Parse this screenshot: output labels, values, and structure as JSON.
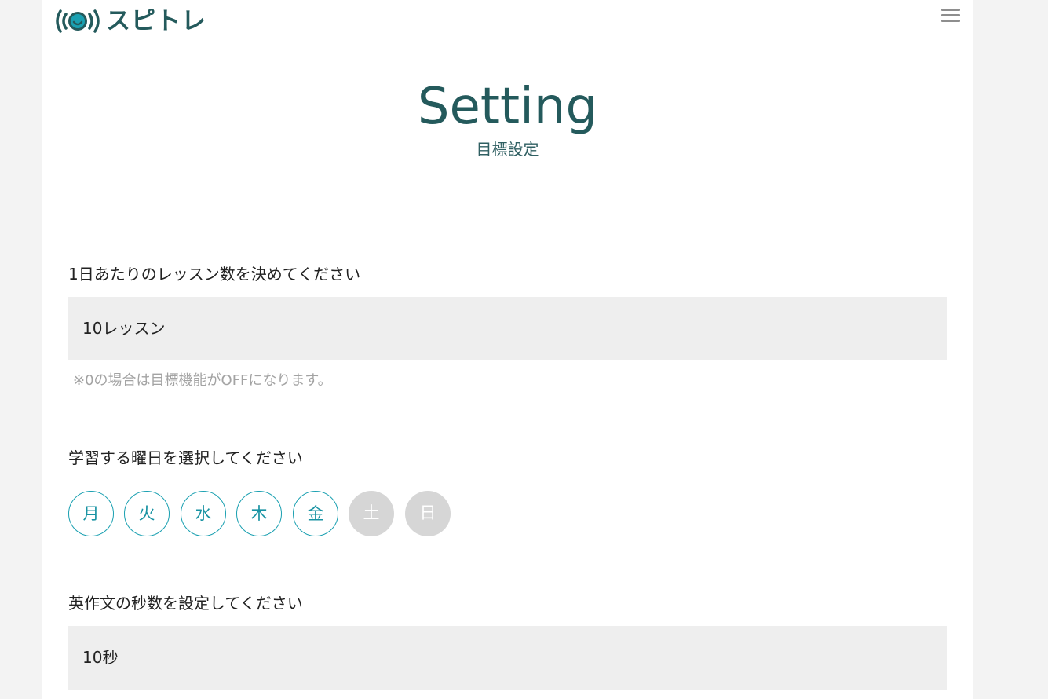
{
  "header": {
    "logo_text": "スピトレ",
    "logo_icon": "sound-wave-face-icon",
    "menu_icon": "hamburger-menu-icon"
  },
  "page": {
    "title": "Setting",
    "subtitle": "目標設定"
  },
  "lessons": {
    "label": "1日あたりのレッスン数を決めてください",
    "value": "10レッスン",
    "note": "※0の場合は目標機能がOFFになります。"
  },
  "days": {
    "label": "学習する曜日を選択してください",
    "items": [
      {
        "label": "月",
        "selected": true
      },
      {
        "label": "火",
        "selected": true
      },
      {
        "label": "水",
        "selected": true
      },
      {
        "label": "木",
        "selected": true
      },
      {
        "label": "金",
        "selected": true
      },
      {
        "label": "土",
        "selected": false
      },
      {
        "label": "日",
        "selected": false
      }
    ]
  },
  "seconds": {
    "label": "英作文の秒数を設定してください",
    "value": "10秒"
  },
  "colors": {
    "brand": "#245a5c",
    "accent": "#1aa0b1",
    "field_bg": "#eeeeee",
    "day_off": "#d6d6d6"
  }
}
